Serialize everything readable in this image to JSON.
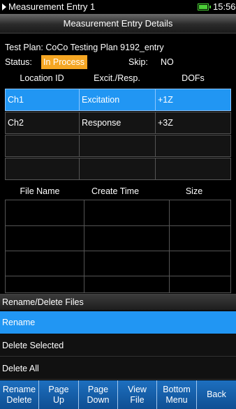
{
  "statusbar": {
    "app_title": "Measurement Entry 1",
    "time": "15:56",
    "battery_color": "#4cd137"
  },
  "header": {
    "title": "Measurement Entry Details"
  },
  "details": {
    "test_plan": "Test Plan: CoCo Testing Plan 9192_entry",
    "status_label": "Status:",
    "status_value": "In Process",
    "skip_label": "Skip:",
    "skip_value": "NO",
    "status_color": "#f5a623"
  },
  "location_table": {
    "headers": [
      "Location ID",
      "Excit./Resp.",
      "DOFs"
    ],
    "rows": [
      [
        "Ch1",
        "Excitation",
        "+1Z"
      ],
      [
        "Ch2",
        "Response",
        "+3Z"
      ],
      [
        "",
        "",
        ""
      ],
      [
        "",
        "",
        ""
      ]
    ]
  },
  "files_table": {
    "headers": [
      "File Name",
      "Create Time",
      "Size"
    ]
  },
  "popup": {
    "title": "Rename/Delete Files",
    "items": [
      "Rename",
      "Delete Selected",
      "Delete All"
    ]
  },
  "softkeys": [
    {
      "line1": "Rename",
      "line2": "Delete"
    },
    {
      "line1": "Page",
      "line2": "Up"
    },
    {
      "line1": "Page",
      "line2": "Down"
    },
    {
      "line1": "View",
      "line2": "File"
    },
    {
      "line1": "Bottom",
      "line2": "Menu"
    },
    {
      "line1": "Back",
      "line2": ""
    }
  ],
  "colors": {
    "accent": "#2196f3",
    "softkey_bg": "#1560ad"
  }
}
